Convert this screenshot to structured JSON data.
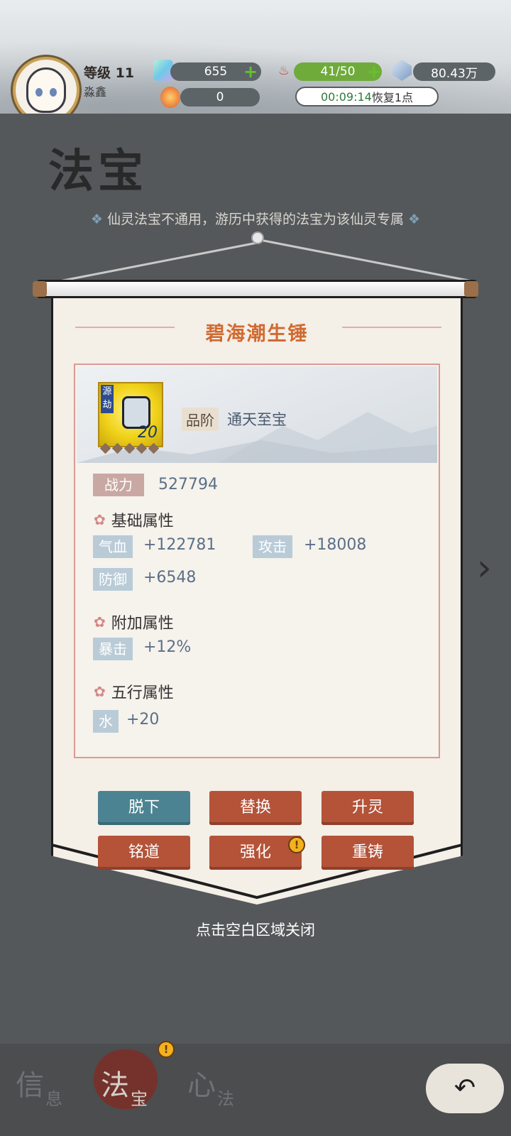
{
  "player": {
    "level_text": "等级 11",
    "name": "淼鑫"
  },
  "resources": {
    "jade": "655",
    "stamina": "41/50",
    "spirit_stone": "80.43万",
    "orb": "0",
    "timer": "00:09:14",
    "timer_suffix": "恢复1点"
  },
  "page": {
    "title": "法宝",
    "hint": "仙灵法宝不通用，游历中获得的法宝为该仙灵专属"
  },
  "item": {
    "name": "碧海潮生锤",
    "icon_tag": "源劫",
    "icon_level": "20",
    "grade_label": "品阶",
    "grade_value": "通天至宝",
    "power_label": "战力",
    "power_value": "527794"
  },
  "sections": {
    "base": "基础属性",
    "extra": "附加属性",
    "element": "五行属性"
  },
  "attributes": {
    "hp_label": "气血",
    "hp_value": "+122781",
    "atk_label": "攻击",
    "atk_value": "+18008",
    "def_label": "防御",
    "def_value": "+6548",
    "crit_label": "暴击",
    "crit_value": "+12%",
    "water_label": "水",
    "water_value": "+20"
  },
  "buttons": {
    "unequip": "脱下",
    "replace": "替换",
    "ascend": "升灵",
    "inscribe": "铭道",
    "enhance": "强化",
    "reforge": "重铸"
  },
  "close_hint": "点击空白区域关闭",
  "tabs": {
    "info_big": "信",
    "info_small": "息",
    "treasure_big": "法",
    "treasure_small": "宝",
    "heart_big": "心",
    "heart_small": "法"
  },
  "colors": {
    "accent_name": "#d06a31",
    "button_blue": "#4c8392",
    "button_red": "#b45338",
    "stamina_green": "#6fab3a"
  }
}
